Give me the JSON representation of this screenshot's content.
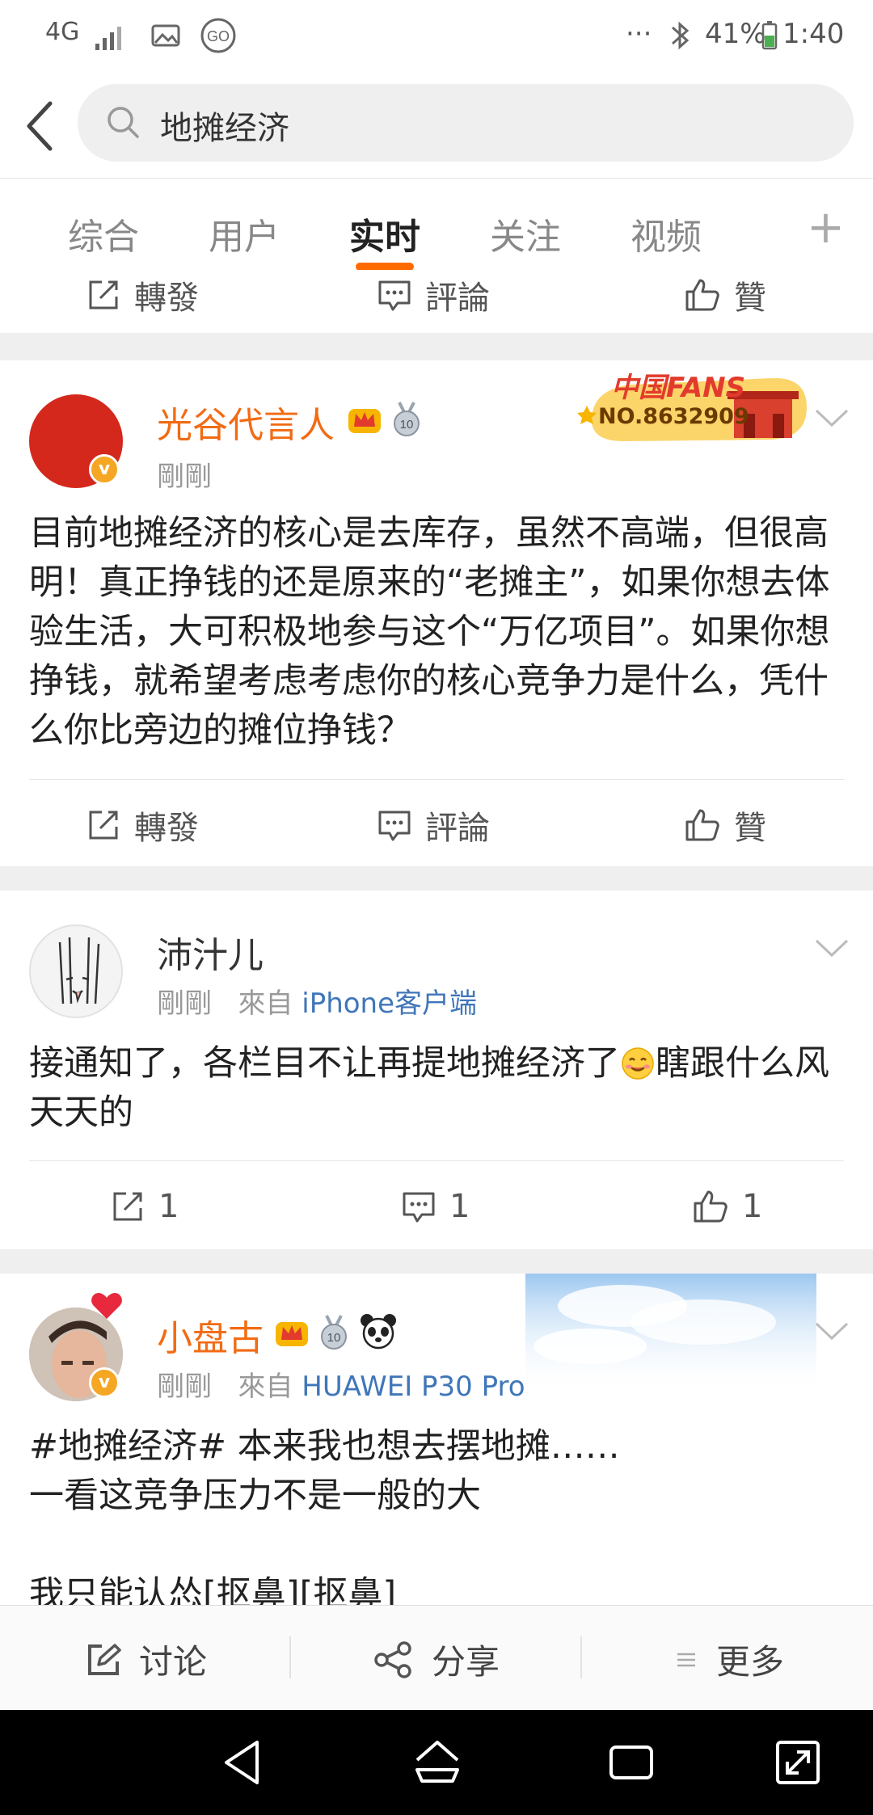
{
  "status_bar": {
    "network": "4G",
    "battery_percent": "41%",
    "time": "1:40",
    "more": "···"
  },
  "search": {
    "query": "地摊经济"
  },
  "tabs": {
    "items": [
      "综合",
      "用户",
      "实时",
      "关注",
      "视频"
    ],
    "active_index": 2,
    "plus": "+"
  },
  "actions_labels": {
    "repost": "轉發",
    "comment": "評論",
    "like": "贊"
  },
  "posts": [
    {
      "username": "光谷代言人",
      "time": "剛剛",
      "fans_badge_title": "中国FANS",
      "fans_badge_number": "NO.8632909",
      "text": "目前地摊经济的核心是去库存，虽然不高端，但很高明！真正挣钱的还是原来的“老摊主”，如果你想去体验生活，大可积极地参与这个“万亿项目”。如果你想挣钱，就希望考虑考虑你的核心竞争力是什么，凭什么你比旁边的摊位挣钱？"
    },
    {
      "username": "沛汁儿",
      "time": "剛剛",
      "source_prefix": "來自",
      "source": "iPhone客户端",
      "text_before_emoji": "接通知了，各栏目不让再提地摊经济了",
      "text_after_emoji": "瞎跟什么风天天的",
      "repost_count": "1",
      "comment_count": "1",
      "like_count": "1"
    },
    {
      "username": "小盘古",
      "time": "剛剛",
      "source_prefix": "來自",
      "source": "HUAWEI P30 Pro",
      "line1": "#地摊经济# 本来我也想去摆地摊……",
      "line2": "一看这竞争压力不是一般的大",
      "line3": "我只能认怂[抠鼻][抠鼻]"
    }
  ],
  "bottom_bar": {
    "discuss": "讨论",
    "share": "分享",
    "more": "更多"
  },
  "colors": {
    "accent": "#ff6a00",
    "username_orange": "#f26b14",
    "source_blue": "#3f76b9",
    "verified_badge": "#f5a623"
  }
}
